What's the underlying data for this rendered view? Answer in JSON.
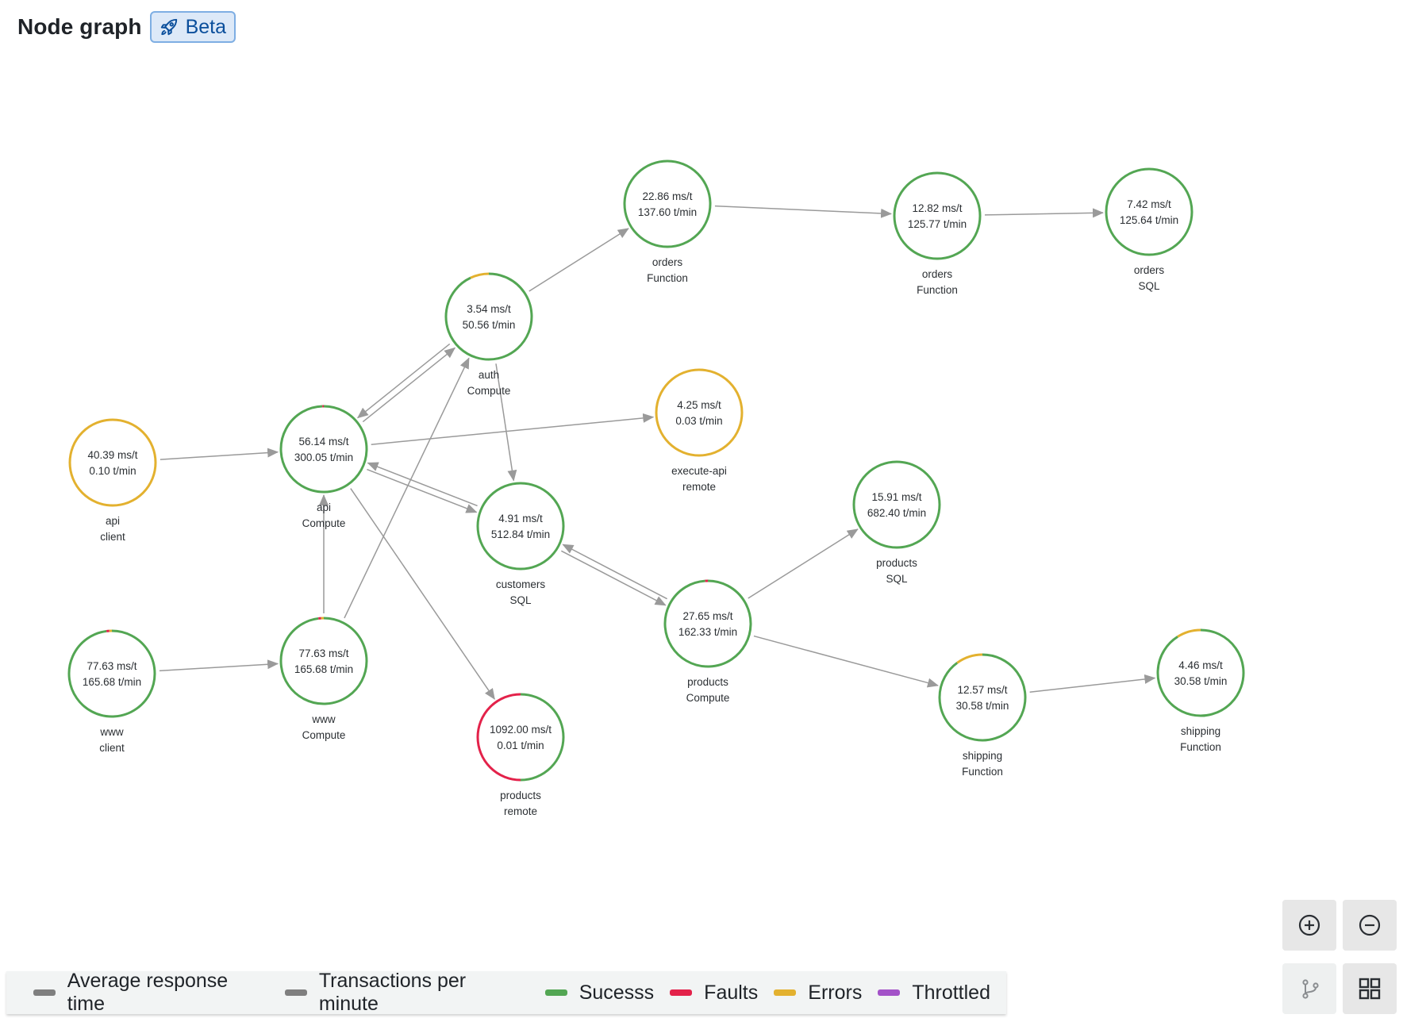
{
  "header": {
    "title": "Node graph",
    "badge_label": "Beta",
    "badge_icon": "rocket-icon"
  },
  "colors": {
    "success": "#53a653",
    "faults": "#e3224a",
    "errors": "#e3b12f",
    "throttled": "#a352c8",
    "edge": "#9a9a9a",
    "response_time": "#7f7f7f",
    "tpm": "#7f7f7f"
  },
  "nodes": [
    {
      "id": "api-client",
      "ms": "40.39 ms/t",
      "tpm": "0.10 t/min",
      "name": "api",
      "type": "client",
      "status": {
        "success": 0,
        "faults": 0,
        "errors": 1,
        "throttled": 0
      }
    },
    {
      "id": "api-compute",
      "ms": "56.14 ms/t",
      "tpm": "300.05 t/min",
      "name": "api",
      "type": "Compute",
      "status": {
        "success": 0.995,
        "faults": 0.005,
        "errors": 0,
        "throttled": 0
      }
    },
    {
      "id": "www-client",
      "ms": "77.63 ms/t",
      "tpm": "165.68 t/min",
      "name": "www",
      "type": "client",
      "status": {
        "success": 0.98,
        "faults": 0.01,
        "errors": 0.01,
        "throttled": 0
      }
    },
    {
      "id": "www-compute",
      "ms": "77.63 ms/t",
      "tpm": "165.68 t/min",
      "name": "www",
      "type": "Compute",
      "status": {
        "success": 0.98,
        "faults": 0.01,
        "errors": 0.01,
        "throttled": 0
      }
    },
    {
      "id": "auth-compute",
      "ms": "3.54 ms/t",
      "tpm": "50.56 t/min",
      "name": "auth",
      "type": "Compute",
      "status": {
        "success": 0.93,
        "faults": 0,
        "errors": 0.07,
        "throttled": 0
      }
    },
    {
      "id": "orders-function-1",
      "ms": "22.86 ms/t",
      "tpm": "137.60 t/min",
      "name": "orders",
      "type": "Function",
      "status": {
        "success": 1,
        "faults": 0,
        "errors": 0,
        "throttled": 0
      }
    },
    {
      "id": "orders-function-2",
      "ms": "12.82 ms/t",
      "tpm": "125.77 t/min",
      "name": "orders",
      "type": "Function",
      "status": {
        "success": 1,
        "faults": 0,
        "errors": 0,
        "throttled": 0
      }
    },
    {
      "id": "orders-sql",
      "ms": "7.42 ms/t",
      "tpm": "125.64 t/min",
      "name": "orders",
      "type": "SQL",
      "status": {
        "success": 1,
        "faults": 0,
        "errors": 0,
        "throttled": 0
      }
    },
    {
      "id": "execute-api-remote",
      "ms": "4.25 ms/t",
      "tpm": "0.03 t/min",
      "name": "execute-api",
      "type": "remote",
      "status": {
        "success": 0,
        "faults": 0,
        "errors": 1,
        "throttled": 0
      }
    },
    {
      "id": "customers-sql",
      "ms": "4.91 ms/t",
      "tpm": "512.84 t/min",
      "name": "customers",
      "type": "SQL",
      "status": {
        "success": 1,
        "faults": 0,
        "errors": 0,
        "throttled": 0
      }
    },
    {
      "id": "products-compute",
      "ms": "27.65 ms/t",
      "tpm": "162.33 t/min",
      "name": "products",
      "type": "Compute",
      "status": {
        "success": 0.99,
        "faults": 0.01,
        "errors": 0,
        "throttled": 0
      }
    },
    {
      "id": "products-sql",
      "ms": "15.91 ms/t",
      "tpm": "682.40 t/min",
      "name": "products",
      "type": "SQL",
      "status": {
        "success": 1,
        "faults": 0,
        "errors": 0,
        "throttled": 0
      }
    },
    {
      "id": "products-remote",
      "ms": "1092.00 ms/t",
      "tpm": "0.01 t/min",
      "name": "products",
      "type": "remote",
      "status": {
        "success": 0.5,
        "faults": 0.5,
        "errors": 0,
        "throttled": 0
      }
    },
    {
      "id": "shipping-function-1",
      "ms": "12.57 ms/t",
      "tpm": "30.58 t/min",
      "name": "shipping",
      "type": "Function",
      "status": {
        "success": 0.9,
        "faults": 0,
        "errors": 0.1,
        "throttled": 0
      }
    },
    {
      "id": "shipping-function-2",
      "ms": "4.46 ms/t",
      "tpm": "30.58 t/min",
      "name": "shipping",
      "type": "Function",
      "status": {
        "success": 0.91,
        "faults": 0,
        "errors": 0.09,
        "throttled": 0
      }
    }
  ],
  "edges": [
    {
      "from": "api-client",
      "to": "api-compute"
    },
    {
      "from": "www-client",
      "to": "www-compute"
    },
    {
      "from": "www-compute",
      "to": "api-compute"
    },
    {
      "from": "www-compute",
      "to": "auth-compute"
    },
    {
      "from": "api-compute",
      "to": "auth-compute"
    },
    {
      "from": "auth-compute",
      "to": "api-compute"
    },
    {
      "from": "api-compute",
      "to": "execute-api-remote"
    },
    {
      "from": "api-compute",
      "to": "customers-sql"
    },
    {
      "from": "customers-sql",
      "to": "api-compute"
    },
    {
      "from": "api-compute",
      "to": "products-remote"
    },
    {
      "from": "auth-compute",
      "to": "orders-function-1"
    },
    {
      "from": "auth-compute",
      "to": "customers-sql"
    },
    {
      "from": "orders-function-1",
      "to": "orders-function-2"
    },
    {
      "from": "orders-function-2",
      "to": "orders-sql"
    },
    {
      "from": "customers-sql",
      "to": "products-compute"
    },
    {
      "from": "products-compute",
      "to": "customers-sql"
    },
    {
      "from": "products-compute",
      "to": "products-sql"
    },
    {
      "from": "products-compute",
      "to": "shipping-function-1"
    },
    {
      "from": "shipping-function-1",
      "to": "shipping-function-2"
    }
  ],
  "legend": [
    {
      "label": "Average response time",
      "color_key": "response_time"
    },
    {
      "label": "Transactions per minute",
      "color_key": "tpm"
    },
    {
      "label": "Sucesss",
      "color_key": "success"
    },
    {
      "label": "Faults",
      "color_key": "faults"
    },
    {
      "label": "Errors",
      "color_key": "errors"
    },
    {
      "label": "Throttled",
      "color_key": "throttled"
    }
  ],
  "controls": {
    "zoom_in": "zoom-in",
    "zoom_out": "zoom-out",
    "graph_layout": "graph-layout",
    "grid_layout": "grid-layout"
  }
}
